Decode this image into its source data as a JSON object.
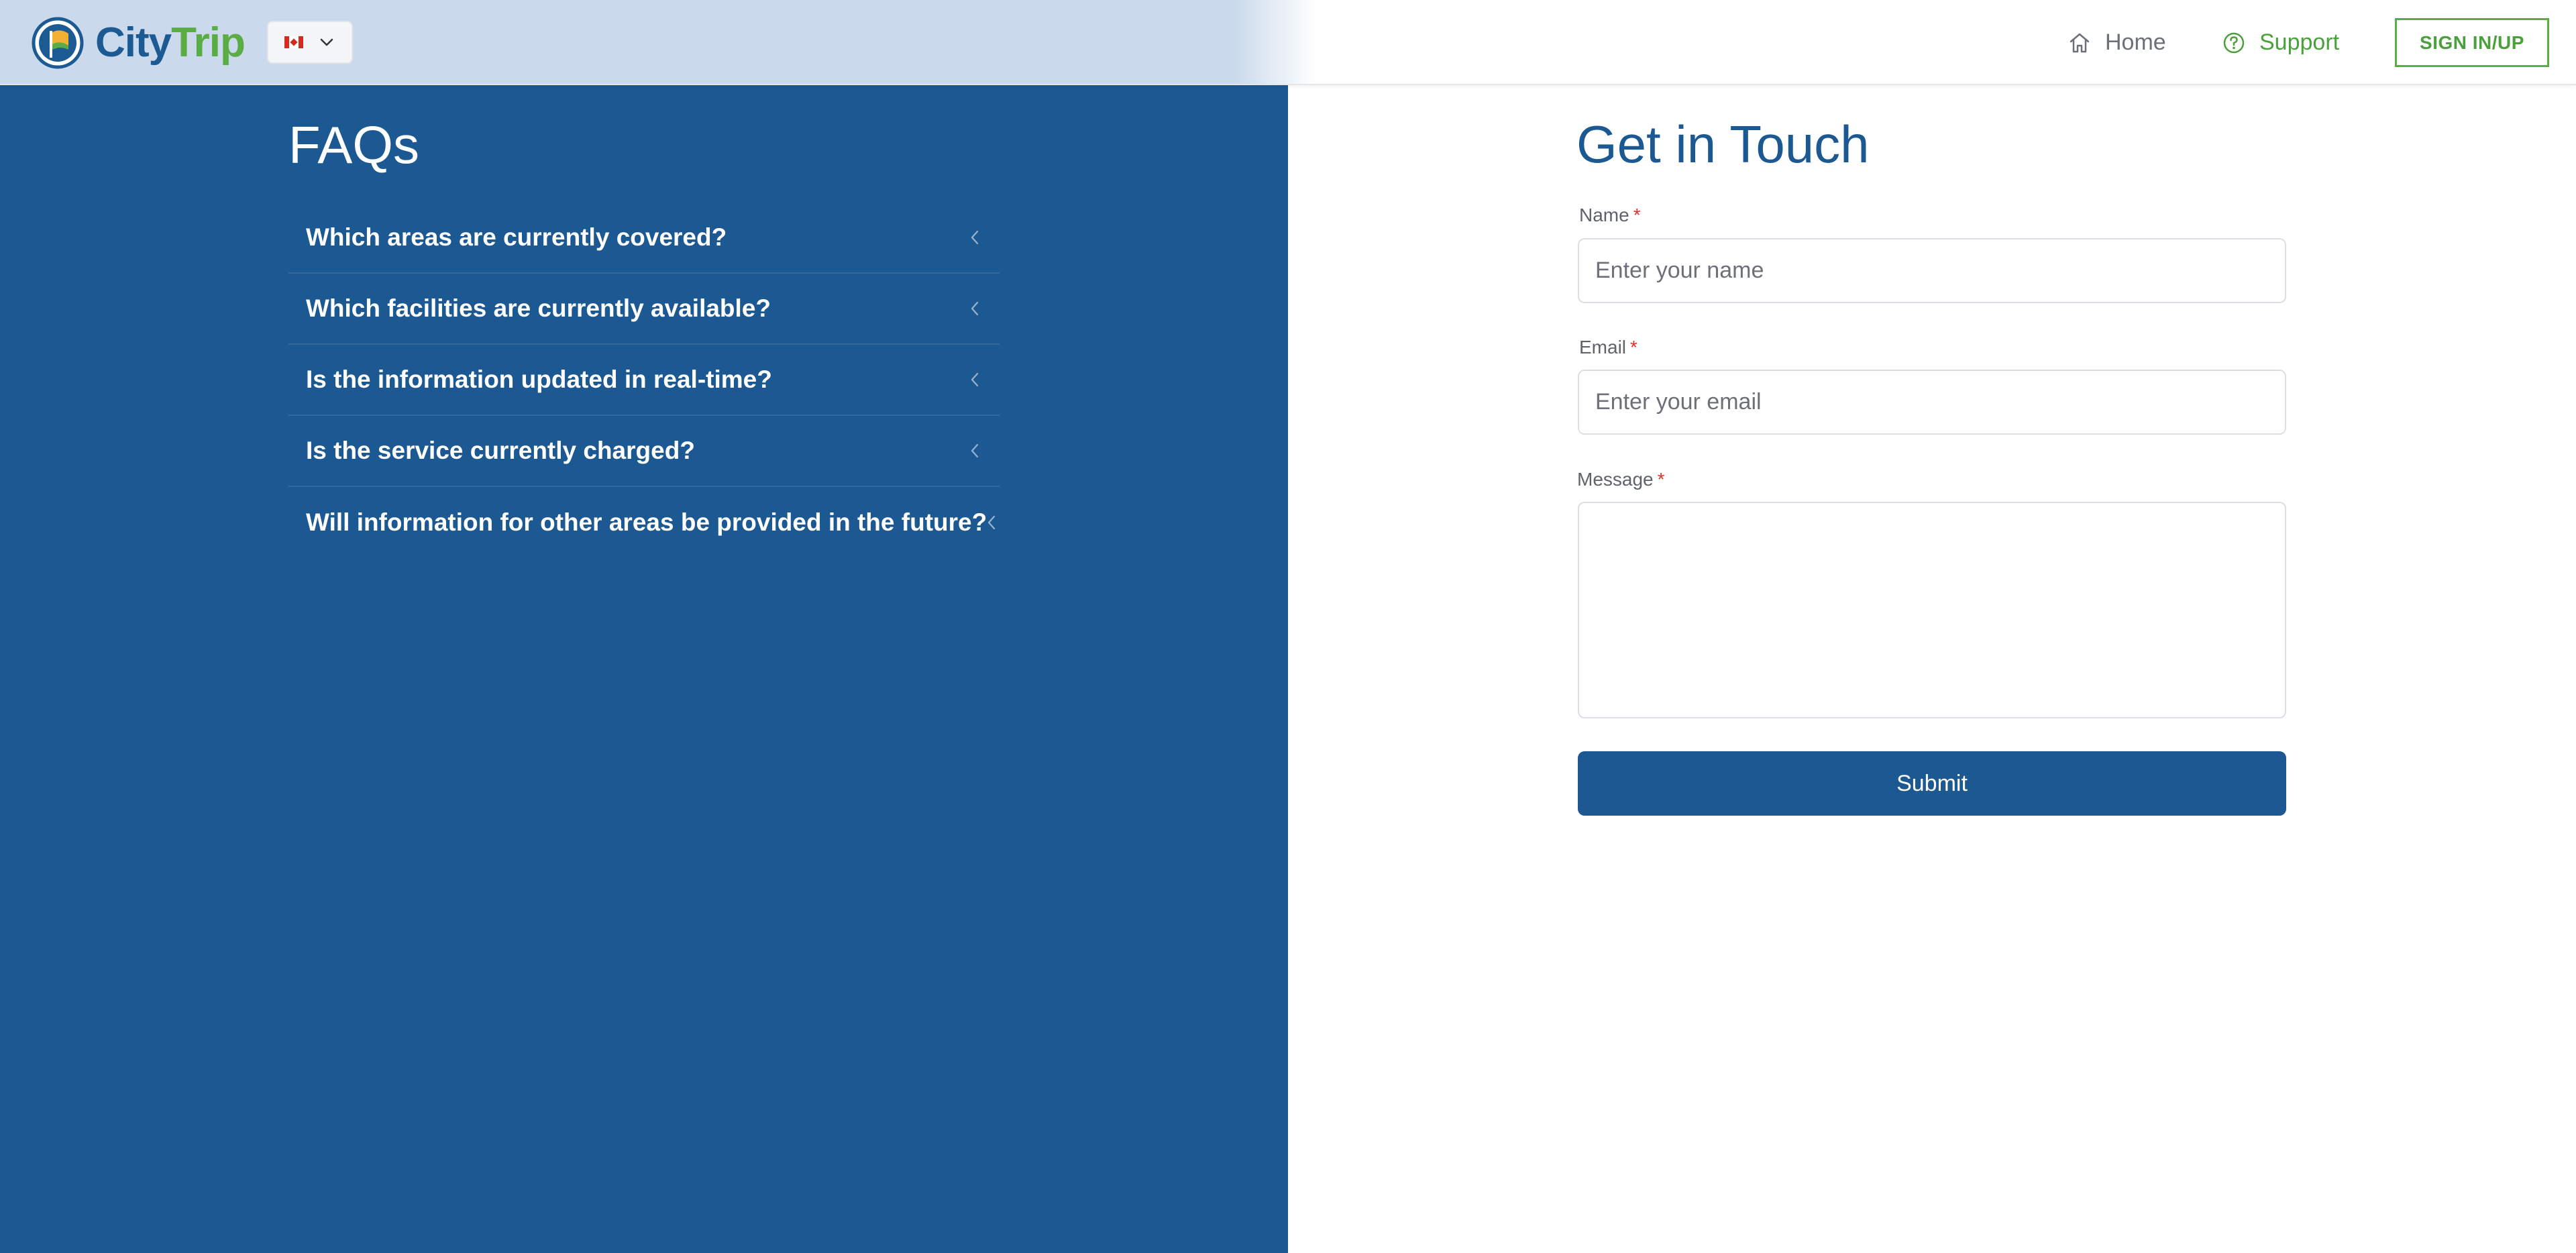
{
  "header": {
    "logo": {
      "text_part1": "City",
      "text_part2": "Trip",
      "icon": "flag-globe-logo"
    },
    "language": {
      "selected": "Canada flag",
      "icon": "chevron-down-icon"
    },
    "nav": [
      {
        "label": "Home",
        "icon": "home-icon"
      },
      {
        "label": "Support",
        "icon": "help-circle-icon"
      }
    ],
    "signin_label": "SIGN IN/UP"
  },
  "faq": {
    "title": "FAQs",
    "items": [
      {
        "question": "Which areas are currently covered?",
        "icon": "chevron-left-icon"
      },
      {
        "question": "Which facilities are currently available?",
        "icon": "chevron-left-icon"
      },
      {
        "question": "Is the information updated in real-time?",
        "icon": "chevron-left-icon"
      },
      {
        "question": "Is the service currently charged?",
        "icon": "chevron-left-icon"
      },
      {
        "question": "Will information for other areas be provided in the future?",
        "icon": "chevron-left-icon"
      }
    ]
  },
  "contact": {
    "title": "Get in Touch",
    "required_mark": "*",
    "name": {
      "label": "Name",
      "placeholder": "Enter your name",
      "value": ""
    },
    "email": {
      "label": "Email",
      "placeholder": "Enter your email",
      "value": ""
    },
    "message": {
      "label": "Message",
      "placeholder": "",
      "value": ""
    },
    "submit_label": "Submit"
  },
  "colors": {
    "brand_blue": "#1c5892",
    "brand_green": "#5aad44",
    "header_tint": "#cad9ec",
    "required": "#e0312b"
  }
}
